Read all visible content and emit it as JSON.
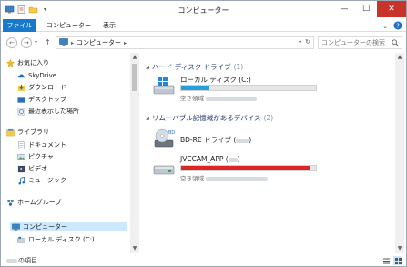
{
  "window": {
    "title": "コンピューター",
    "controls": {
      "minimize": "—",
      "maximize": "☐",
      "close": "✕"
    }
  },
  "ribbon": {
    "tabs": [
      {
        "label": "ファイル",
        "active": true
      },
      {
        "label": "コンピューター"
      },
      {
        "label": "表示"
      }
    ]
  },
  "address": {
    "back_arrow": "←",
    "forward_arrow": "→",
    "up_arrow": "↑",
    "separator": "▸",
    "crumb": "コンピューター",
    "refresh": "↻",
    "search_placeholder": "コンピューターの検索"
  },
  "nav": {
    "favorites_label": "お気に入り",
    "favorites": [
      {
        "label": "SkyDrive",
        "icon": "skydrive-icon"
      },
      {
        "label": "ダウンロード",
        "icon": "download-icon"
      },
      {
        "label": "デスクトップ",
        "icon": "desktop-icon"
      },
      {
        "label": "最近表示した場所",
        "icon": "recent-places-icon"
      }
    ],
    "libraries_label": "ライブラリ",
    "libraries": [
      {
        "label": "ドキュメント",
        "icon": "documents-icon"
      },
      {
        "label": "ピクチャ",
        "icon": "pictures-icon"
      },
      {
        "label": "ビデオ",
        "icon": "videos-icon"
      },
      {
        "label": "ミュージック",
        "icon": "music-icon"
      }
    ],
    "homegroup_label": "ホームグループ",
    "computer_label": "コンピューター",
    "computer_children": [
      {
        "label": "ローカル ディスク (C:)",
        "icon": "local-disk-icon"
      }
    ]
  },
  "content": {
    "hdd_group": {
      "label": "ハード ディスク ドライブ",
      "count": "(1)"
    },
    "hdd_drives": [
      {
        "name": "ローカル ディスク (C:)",
        "free_label": "空き領域",
        "used_fraction": 0.2,
        "bar_color": "#26a0da"
      }
    ],
    "removable_group": {
      "label": "リムーバブル記憶域があるデバイス",
      "count": "(2)"
    },
    "removable": [
      {
        "name": "BD-RE ドライブ (",
        "name_end": ")"
      },
      {
        "name": "JVCCAM_APP (",
        "name_end": ")",
        "free_label": "空き領域",
        "used_fraction": 0.95,
        "bar_color": "#da2626"
      }
    ]
  },
  "status": {
    "items_suffix": "の項目"
  }
}
